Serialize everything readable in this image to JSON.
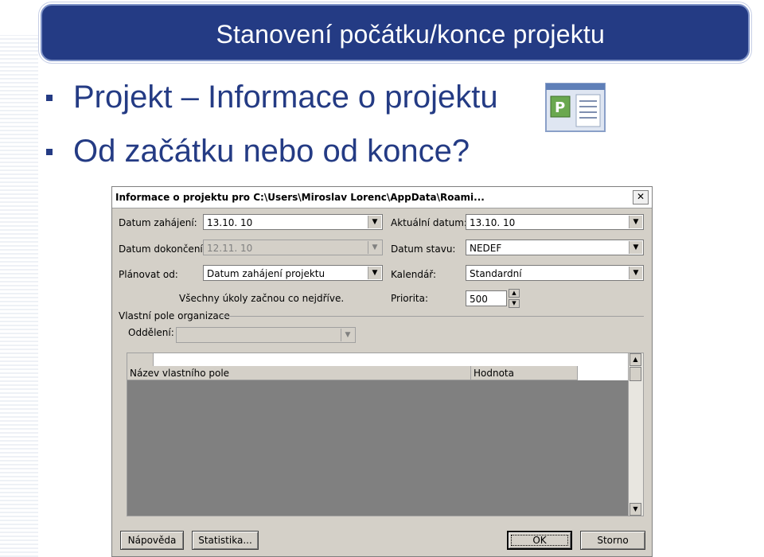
{
  "slide": {
    "title": "Stanovení počátku/konce projektu",
    "bullets": [
      "Projekt – Informace o projektu",
      "Od začátku nebo od konce?"
    ],
    "icon": "project-info-icon",
    "accent_color": "#243b84"
  },
  "dialog": {
    "title": "Informace o projektu pro C:\\Users\\Miroslav Lorenc\\AppData\\Roami...",
    "close_glyph": "✕",
    "fields": {
      "start_date": {
        "label": "Datum zahájení:",
        "value": "13.10. 10"
      },
      "finish_date": {
        "label": "Datum dokončení:",
        "value": "12.11. 10"
      },
      "schedule_from": {
        "label": "Plánovat od:",
        "value": "Datum zahájení projektu"
      },
      "schedule_note": "Všechny úkoly začnou co nejdříve.",
      "current_date": {
        "label": "Aktuální datum:",
        "value": "13.10. 10"
      },
      "status_date": {
        "label": "Datum stavu:",
        "value": "NEDEF"
      },
      "calendar": {
        "label": "Kalendář:",
        "value": "Standardní"
      },
      "priority": {
        "label": "Priorita:",
        "value": "500"
      }
    },
    "custom_fields": {
      "group_label": "Vlastní pole organizace",
      "department_label": "Oddělení:",
      "department_value": "",
      "columns": [
        "Název vlastního pole",
        "Hodnota"
      ]
    },
    "buttons": {
      "help": "Nápověda",
      "statistics": "Statistika...",
      "ok": "OK",
      "cancel": "Storno"
    }
  }
}
